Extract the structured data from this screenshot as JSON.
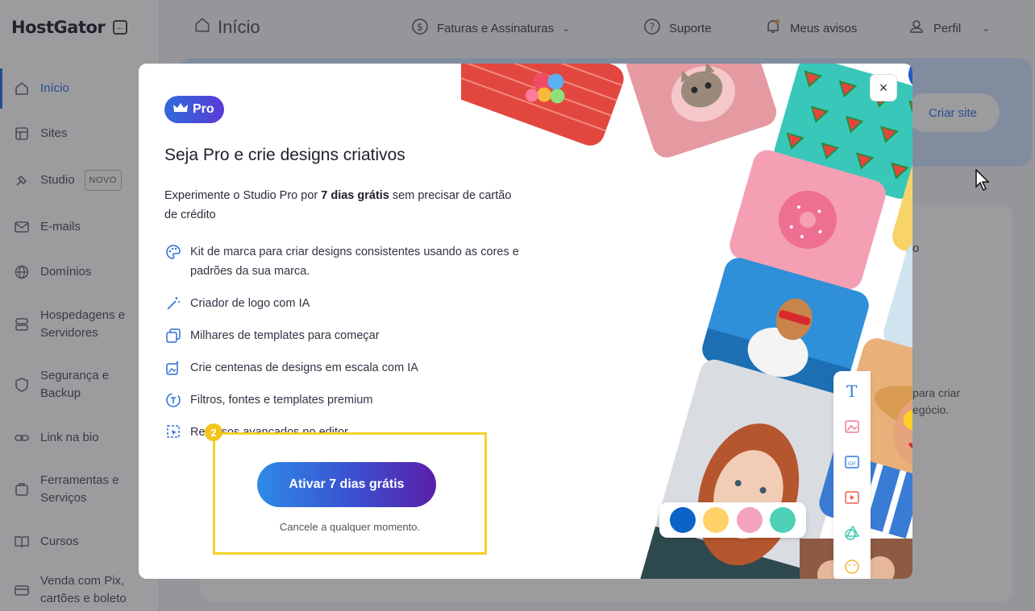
{
  "app": {
    "logo": "HostGator",
    "page_title": "Início"
  },
  "sidebar": {
    "items": [
      {
        "label": "Início",
        "icon": "home-icon",
        "active": true
      },
      {
        "label": "Sites",
        "icon": "layout-icon"
      },
      {
        "label": "Studio",
        "icon": "brush-icon",
        "badge": "NOVO"
      },
      {
        "label": "E-mails",
        "icon": "mail-icon"
      },
      {
        "label": "Domínios",
        "icon": "globe-icon"
      },
      {
        "label": "Hospedagens e Servidores",
        "icon": "server-icon"
      },
      {
        "label": "Segurança e Backup",
        "icon": "shield-icon"
      },
      {
        "label": "Link na bio",
        "icon": "link-icon"
      },
      {
        "label": "Ferramentas e Serviços",
        "icon": "tools-icon"
      },
      {
        "label": "Cursos",
        "icon": "book-icon"
      },
      {
        "label": "Venda com Pix, cartões e boleto",
        "icon": "payment-icon"
      }
    ]
  },
  "topbar": {
    "faturas": "Faturas e Assinaturas",
    "suporte": "Suporte",
    "avisos": "Meus avisos",
    "perfil": "Perfil"
  },
  "background": {
    "criar_site": "Criar site",
    "lower_text_1": "o",
    "lower_text_2a": "para criar",
    "lower_text_2b": "egócio."
  },
  "modal": {
    "badge": "Pro",
    "title": "Seja Pro e crie designs criativos",
    "subtitle_pre": "Experimente o Studio Pro por ",
    "subtitle_bold": "7 dias grátis",
    "subtitle_post": " sem precisar de cartão de crédito",
    "features": [
      {
        "text": "Kit de marca para criar designs consistentes usando as cores e padrões da sua marca.",
        "icon": "palette-icon"
      },
      {
        "text": "Criador de logo com IA",
        "icon": "magic-wand-icon"
      },
      {
        "text": "Milhares de templates para começar",
        "icon": "copy-icon"
      },
      {
        "text": "Crie centenas de designs em escala com IA",
        "icon": "images-icon"
      },
      {
        "text": "Filtros, fontes e templates premium",
        "icon": "text-sparkle-icon"
      },
      {
        "text": "Recursos avançados no editor",
        "icon": "select-icon"
      }
    ],
    "step_number": "2",
    "cta": "Ativar 7 dias grátis",
    "cancel_note": "Cancele a qualquer momento.",
    "close_label": "×",
    "swatches": [
      "#0b63c8",
      "#ffd166",
      "#f4a3bd",
      "#4fd1b8"
    ]
  }
}
